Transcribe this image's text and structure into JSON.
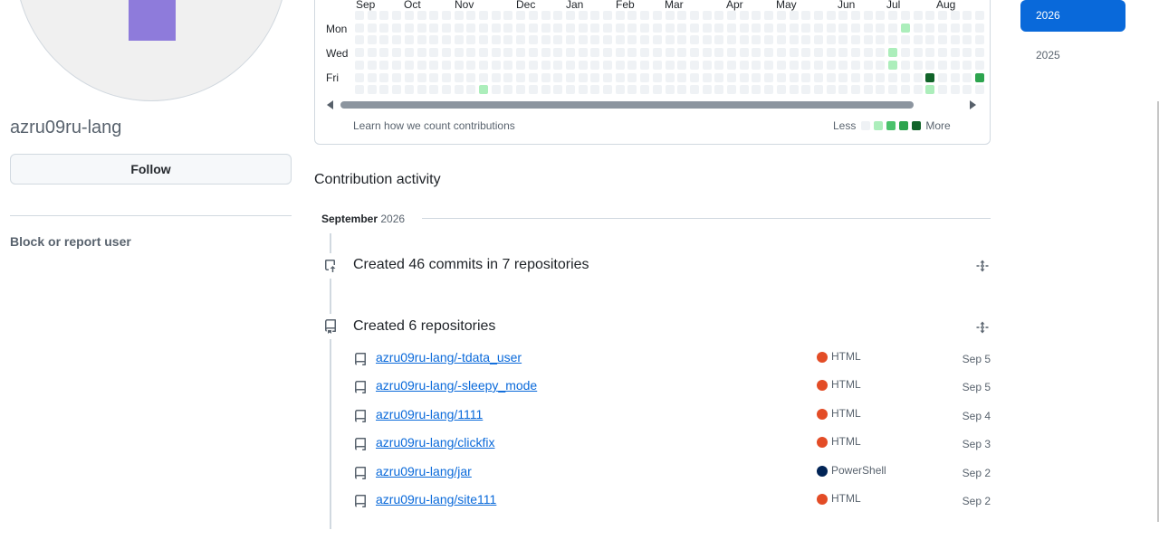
{
  "profile": {
    "username": "azru09ru-lang",
    "follow_label": "Follow",
    "block_label": "Block or report user",
    "identicon_color": "#8e7bdb"
  },
  "calendar": {
    "months": [
      "Sep",
      "Oct",
      "Nov",
      "Dec",
      "Jan",
      "Feb",
      "Mar",
      "Apr",
      "May",
      "Jun",
      "Jul",
      "Aug"
    ],
    "day_labels": [
      "Mon",
      "Wed",
      "Fri"
    ],
    "learn_link": "Learn how we count contributions",
    "legend_less": "Less",
    "legend_more": "More",
    "level_colors": [
      "#eff2f5",
      "#aceebb",
      "#4ac26b",
      "#2da44e",
      "#116329"
    ],
    "weeks": 53,
    "active_cells": [
      {
        "week": 10,
        "day": 6,
        "level": 1
      },
      {
        "week": 55,
        "day": 1,
        "level": 1
      },
      {
        "week": 54,
        "day": 3,
        "level": 1
      },
      {
        "week": 54,
        "day": 4,
        "level": 1
      },
      {
        "week": 57,
        "day": 5,
        "level": 4
      },
      {
        "week": 57,
        "day": 6,
        "level": 1
      },
      {
        "week": 61,
        "day": 5,
        "level": 3
      }
    ]
  },
  "years": [
    "2026",
    "2025"
  ],
  "activity": {
    "title": "Contribution activity",
    "month_name": "September",
    "month_year": "2026",
    "commits_summary": "Created 46 commits in 7 repositories",
    "repos_summary": "Created 6 repositories",
    "repos": [
      {
        "name": "azru09ru-lang/-tdata_user",
        "language": "HTML",
        "lang_color": "#e34c26",
        "date": "Sep 5"
      },
      {
        "name": "azru09ru-lang/-sleepy_mode",
        "language": "HTML",
        "lang_color": "#e34c26",
        "date": "Sep 5"
      },
      {
        "name": "azru09ru-lang/1111",
        "language": "HTML",
        "lang_color": "#e34c26",
        "date": "Sep 4"
      },
      {
        "name": "azru09ru-lang/clickfix",
        "language": "HTML",
        "lang_color": "#e34c26",
        "date": "Sep 3"
      },
      {
        "name": "azru09ru-lang/jar",
        "language": "PowerShell",
        "lang_color": "#012456",
        "date": "Sep 2"
      },
      {
        "name": "azru09ru-lang/site111",
        "language": "HTML",
        "lang_color": "#e34c26",
        "date": "Sep 2"
      }
    ]
  }
}
